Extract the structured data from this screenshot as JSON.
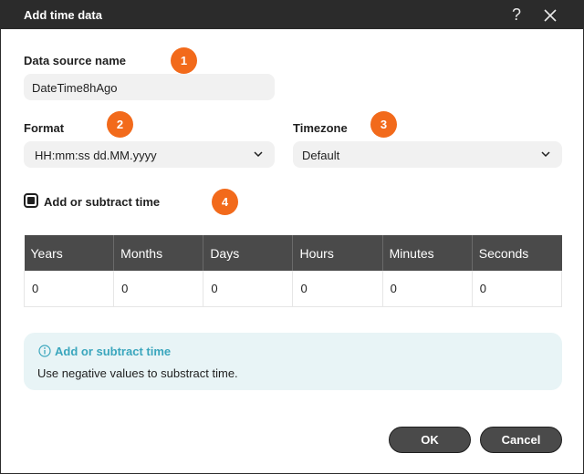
{
  "window": {
    "title": "Add time data"
  },
  "fields": {
    "data_source_name": {
      "label": "Data source name",
      "value": "DateTime8hAgo"
    },
    "format": {
      "label": "Format",
      "value": "HH:mm:ss dd.MM.yyyy"
    },
    "timezone": {
      "label": "Timezone",
      "value": "Default"
    }
  },
  "badges": [
    "1",
    "2",
    "3",
    "4"
  ],
  "add_subtract": {
    "label": "Add or subtract time",
    "checked": true
  },
  "time_table": {
    "headers": [
      "Years",
      "Months",
      "Days",
      "Hours",
      "Minutes",
      "Seconds"
    ],
    "values": [
      "0",
      "0",
      "0",
      "0",
      "0",
      "0"
    ]
  },
  "info": {
    "title": "Add or subtract time",
    "text": "Use negative values to substract time."
  },
  "buttons": {
    "ok": "OK",
    "cancel": "Cancel"
  },
  "colors": {
    "badge": "#f26a1b",
    "titlebar": "#2b2b2b",
    "info_accent": "#3aa6bd"
  },
  "icons": {
    "help": "question-icon",
    "close": "close-icon",
    "info": "info-icon"
  }
}
